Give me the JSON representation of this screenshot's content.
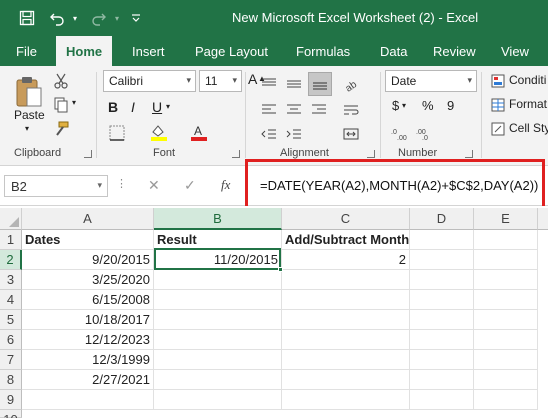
{
  "window": {
    "title": "New Microsoft Excel Worksheet (2)  -  Excel"
  },
  "tabs": [
    "File",
    "Home",
    "Insert",
    "Page Layout",
    "Formulas",
    "Data",
    "Review",
    "View"
  ],
  "ribbon": {
    "clipboard": {
      "label": "Clipboard",
      "paste_label": "Paste"
    },
    "font": {
      "label": "Font",
      "family": "Calibri",
      "size": "11",
      "bold": "B",
      "italic": "I",
      "underline": "U",
      "grow": "A",
      "shrink": "A",
      "highlight_color": "#ffff00",
      "font_color": "#e02020"
    },
    "alignment": {
      "label": "Alignment"
    },
    "number": {
      "label": "Number",
      "format": "Date",
      "currency": "$",
      "percent": "%",
      "comma": "9"
    },
    "styles": {
      "items": [
        "Conditi",
        "Format",
        "Cell Sty"
      ]
    }
  },
  "formula_bar": {
    "name_box": "B2",
    "cancel": "✕",
    "enter": "✓",
    "fx": "fx",
    "formula": "=DATE(YEAR(A2),MONTH(A2)+$C$2,DAY(A2))"
  },
  "grid": {
    "columns": [
      "A",
      "B",
      "C",
      "D",
      "E"
    ],
    "rows": [
      "1",
      "2",
      "3",
      "4",
      "5",
      "6",
      "7",
      "8",
      "9",
      "10"
    ],
    "headers": {
      "a": "Dates",
      "b": "Result",
      "c": "Add/Subtract Month"
    },
    "dates": [
      "9/20/2015",
      "3/25/2020",
      "6/15/2008",
      "10/18/2017",
      "12/12/2023",
      "12/3/1999",
      "2/27/2021"
    ],
    "result_b2": "11/20/2015",
    "month_c2": "2"
  },
  "colors": {
    "brand": "#217346",
    "highlight": "#e02020"
  }
}
